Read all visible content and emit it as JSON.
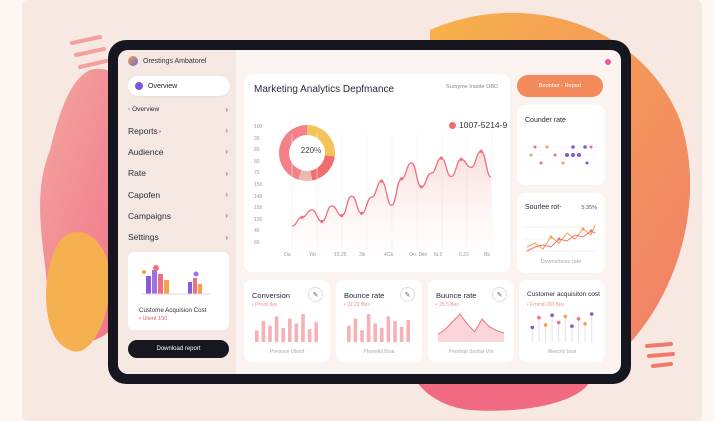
{
  "app": {
    "title": "Orestings Ambatorel"
  },
  "overview_pill": {
    "label": "Overview"
  },
  "sidebar": {
    "items": [
      {
        "label": "Overview",
        "small": true
      },
      {
        "label": "Reports",
        "badge": "•"
      },
      {
        "label": "Audience"
      },
      {
        "label": "Rate"
      },
      {
        "label": "Capofen"
      },
      {
        "label": "Campaigns"
      },
      {
        "label": "Settings"
      }
    ],
    "chevron": "›"
  },
  "cac_card": {
    "title": "Custome Acquision Cost",
    "sub": "• Ulient 150"
  },
  "download_button": {
    "label": "Download report"
  },
  "main_chart": {
    "title": "Marketing Analytics Depfmance",
    "right_label": "Sumyme Irastte OBD",
    "value": "1007-5214-9",
    "donut_label": "220%"
  },
  "chart_data": {
    "type": "line",
    "title": "",
    "y_ticks": [
      "100",
      "90",
      "80",
      "80",
      "70",
      "150",
      "140",
      "150",
      "130",
      "40",
      "60"
    ],
    "x_ticks": [
      "Oa",
      "Yib",
      "15.25",
      "3ls",
      "4CE",
      "Oo. Dile",
      "Ib.5",
      "5.22",
      "Bk"
    ],
    "x": [
      0,
      1,
      2,
      3,
      4,
      5,
      6,
      7,
      8,
      9,
      10,
      11,
      12,
      13,
      14,
      15,
      16,
      17,
      18,
      19,
      20
    ],
    "values": [
      40,
      55,
      68,
      48,
      75,
      58,
      92,
      62,
      90,
      118,
      76,
      122,
      150,
      108,
      132,
      158,
      126,
      156,
      142,
      170,
      125
    ],
    "ylim": [
      0,
      200
    ],
    "donut": [
      {
        "share": 0.27,
        "color": "#f6c35a"
      },
      {
        "share": 0.2,
        "color": "#f26d6d"
      },
      {
        "share": 0.08,
        "color": "#ecb9b4"
      },
      {
        "share": 0.45,
        "color": "#f5808a"
      }
    ]
  },
  "top_right_button": {
    "label": "Boonber  -  Report"
  },
  "counter_card": {
    "title": "Counder rate"
  },
  "source_card": {
    "title": "Sourlee rot-",
    "value": "5.35%",
    "footer": "Dewnshiess rate"
  },
  "bottom_cards": [
    {
      "title": "Conversion",
      "sub": "• Phsot 8es",
      "footer": "Peesove Obsof",
      "spark": [
        10,
        18,
        14,
        22,
        12,
        20,
        16,
        24,
        11,
        17
      ]
    },
    {
      "title": "Bounce rate",
      "sub": "• 22.22 Bes",
      "footer": "Phonelid Boat",
      "spark": [
        14,
        20,
        10,
        24,
        16,
        12,
        22,
        18,
        13,
        19
      ]
    },
    {
      "title": "Buunce rate",
      "sub": "• 25.5 Bes",
      "footer": "Peorhap Sootist Vot",
      "spark": [
        6,
        10,
        16,
        22,
        14,
        8,
        18,
        12,
        9,
        7
      ]
    },
    {
      "title": "Customer acquisiton cost",
      "sub": "• Fromd 200 Bes",
      "footer": "Weecinl boat",
      "spark": [
        12,
        20,
        14,
        22,
        16,
        21,
        13,
        19,
        15,
        23
      ]
    }
  ],
  "colors": {
    "accent_orange": "#f28a5c",
    "accent_pink": "#f26d7d",
    "accent_purple": "#7b5ad9",
    "frame": "#161620"
  },
  "icons": {
    "pen": "✎"
  }
}
